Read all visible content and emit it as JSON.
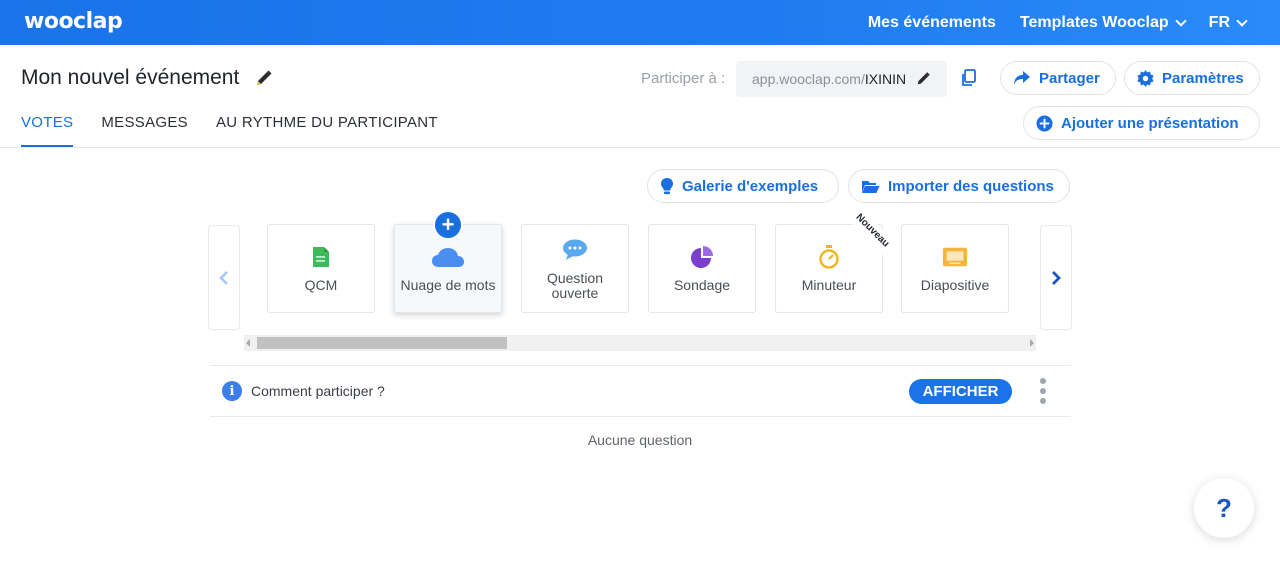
{
  "topbar": {
    "logo": "wooclap",
    "nav": [
      {
        "label": "Mes événements"
      },
      {
        "label": "Templates Wooclap"
      },
      {
        "label": "FR"
      }
    ]
  },
  "event": {
    "title": "Mon nouvel événement",
    "participate_label": "Participer à :",
    "url_prefix": "app.wooclap.com/",
    "url_code": "IXININ",
    "share_label": "Partager",
    "settings_label": "Paramètres",
    "add_presentation_label": "Ajouter une présentation"
  },
  "tabs": [
    {
      "label": "VOTES",
      "active": true
    },
    {
      "label": "MESSAGES",
      "active": false
    },
    {
      "label": "AU RYTHME DU PARTICIPANT",
      "active": false
    }
  ],
  "actions": {
    "gallery_label": "Galerie d'exemples",
    "import_label": "Importer des questions"
  },
  "question_types": [
    {
      "label": "QCM",
      "icon": "qcm-icon"
    },
    {
      "label": "Nuage de mots",
      "icon": "cloud-icon"
    },
    {
      "label": "Question ouverte",
      "icon": "chat-bubble-icon"
    },
    {
      "label": "Sondage",
      "icon": "pie-chart-icon"
    },
    {
      "label": "Minuteur",
      "icon": "stopwatch-icon",
      "badge": "Nouveau"
    },
    {
      "label": "Diapositive",
      "icon": "slide-icon"
    }
  ],
  "participation": {
    "label": "Comment participer ?",
    "button": "AFFICHER"
  },
  "empty_state": "Aucune question",
  "help_label": "?",
  "colors": {
    "brand": "#1a73e8",
    "link": "#1a6fe0",
    "qcm": "#3dbb5c",
    "cloud": "#4a8ef0",
    "chat": "#5aa9f0",
    "poll": "#7a3fd0",
    "timer": "#f1b51c",
    "slide": "#f5b53d"
  }
}
